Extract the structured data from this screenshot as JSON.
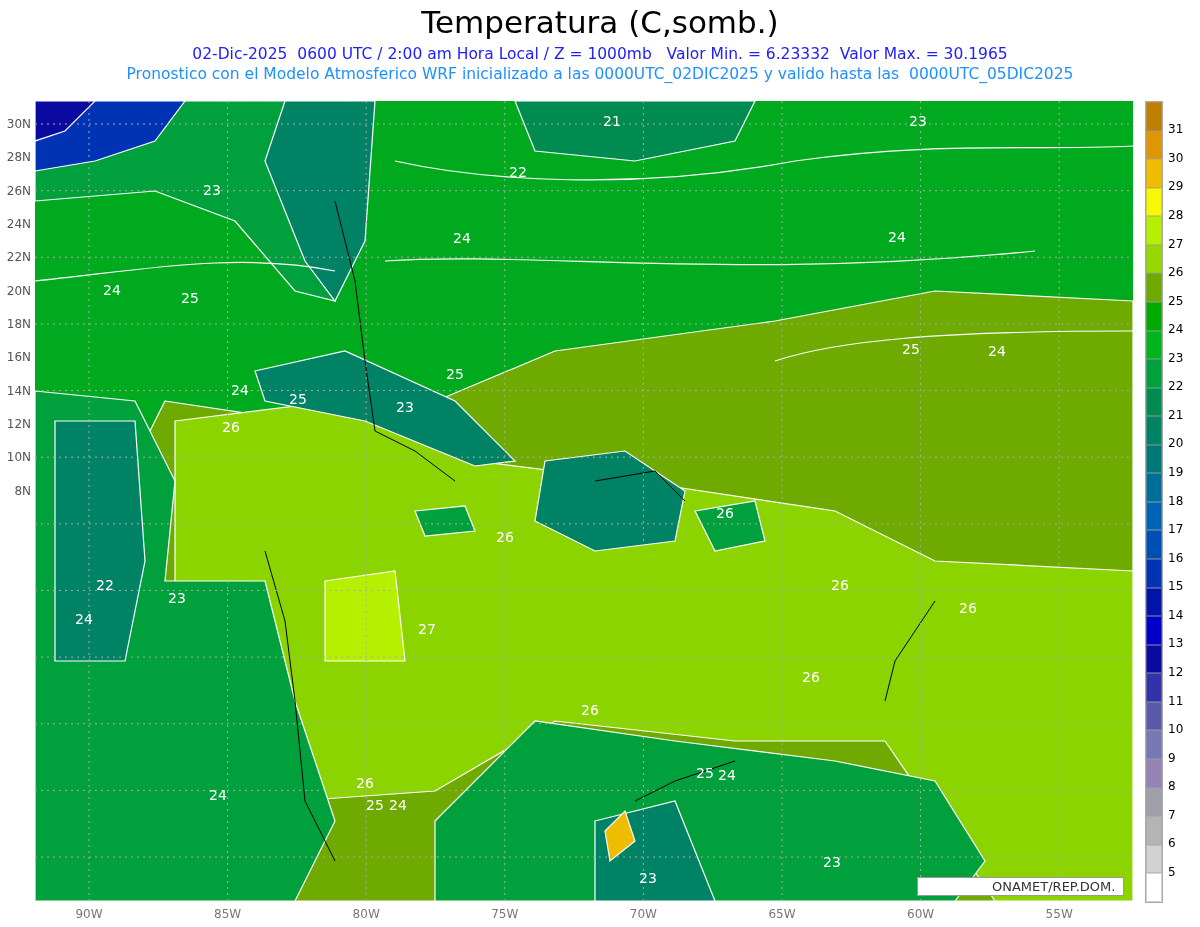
{
  "title": "Temperatura (C,somb.)",
  "subtitle": "02-Dic-2025  0600 UTC / 2:00 am Hora Local / Z = 1000mb   Valor Min. = 6.23332  Valor Max. = 30.1965",
  "description": "Pronostico con el Modelo Atmosferico WRF inicializado a las 0000UTC_02DIC2025 y valido hasta las  0000UTC_05DIC2025",
  "map": {
    "contour_labels": [
      "21",
      "23",
      "22",
      "23",
      "24",
      "24",
      "24",
      "25",
      "25",
      "24",
      "25",
      "24",
      "25",
      "23",
      "26",
      "26",
      "26",
      "22",
      "23",
      "24",
      "27",
      "26",
      "26",
      "26",
      "26",
      "25",
      "24",
      "24",
      "26",
      "25",
      "24",
      "23",
      "23"
    ],
    "lat_labels": [
      "30N",
      "28N",
      "26N",
      "24N",
      "22N",
      "20N",
      "18N",
      "16N",
      "14N",
      "12N",
      "10N",
      "8N"
    ],
    "lon_labels": [
      "90W",
      "85W",
      "80W",
      "75W",
      "70W",
      "65W",
      "60W",
      "55W"
    ],
    "credit": "ONAMET/REP.DOM."
  },
  "colorbar": {
    "swatches": [
      {
        "color": "#c07f00"
      },
      {
        "color": "#e09600"
      },
      {
        "color": "#f0bc00"
      },
      {
        "color": "#f8f800"
      },
      {
        "color": "#b4f000"
      },
      {
        "color": "#96d800"
      },
      {
        "color": "#6eaa00"
      },
      {
        "color": "#00aa00"
      },
      {
        "color": "#00b41e"
      },
      {
        "color": "#00a03c"
      },
      {
        "color": "#008c50"
      },
      {
        "color": "#008264"
      },
      {
        "color": "#007878"
      },
      {
        "color": "#006e96"
      },
      {
        "color": "#0064b4"
      },
      {
        "color": "#0050b4"
      },
      {
        "color": "#0032b4"
      },
      {
        "color": "#0014aa"
      },
      {
        "color": "#0000c8"
      },
      {
        "color": "#0a0aa0"
      },
      {
        "color": "#3232aa"
      },
      {
        "color": "#5a5aaa"
      },
      {
        "color": "#7878b4"
      },
      {
        "color": "#9682b4"
      },
      {
        "color": "#a0a0aa"
      },
      {
        "color": "#b4b4b4"
      },
      {
        "color": "#d2d2d2"
      },
      {
        "color": "#ffffff"
      }
    ],
    "labels": [
      "31",
      "30",
      "29",
      "28",
      "27",
      "26",
      "25",
      "24",
      "23",
      "22",
      "21",
      "20",
      "19",
      "18",
      "17",
      "16",
      "15",
      "14",
      "13",
      "12",
      "11",
      "10",
      "9",
      "8",
      "7",
      "6",
      "5"
    ]
  }
}
